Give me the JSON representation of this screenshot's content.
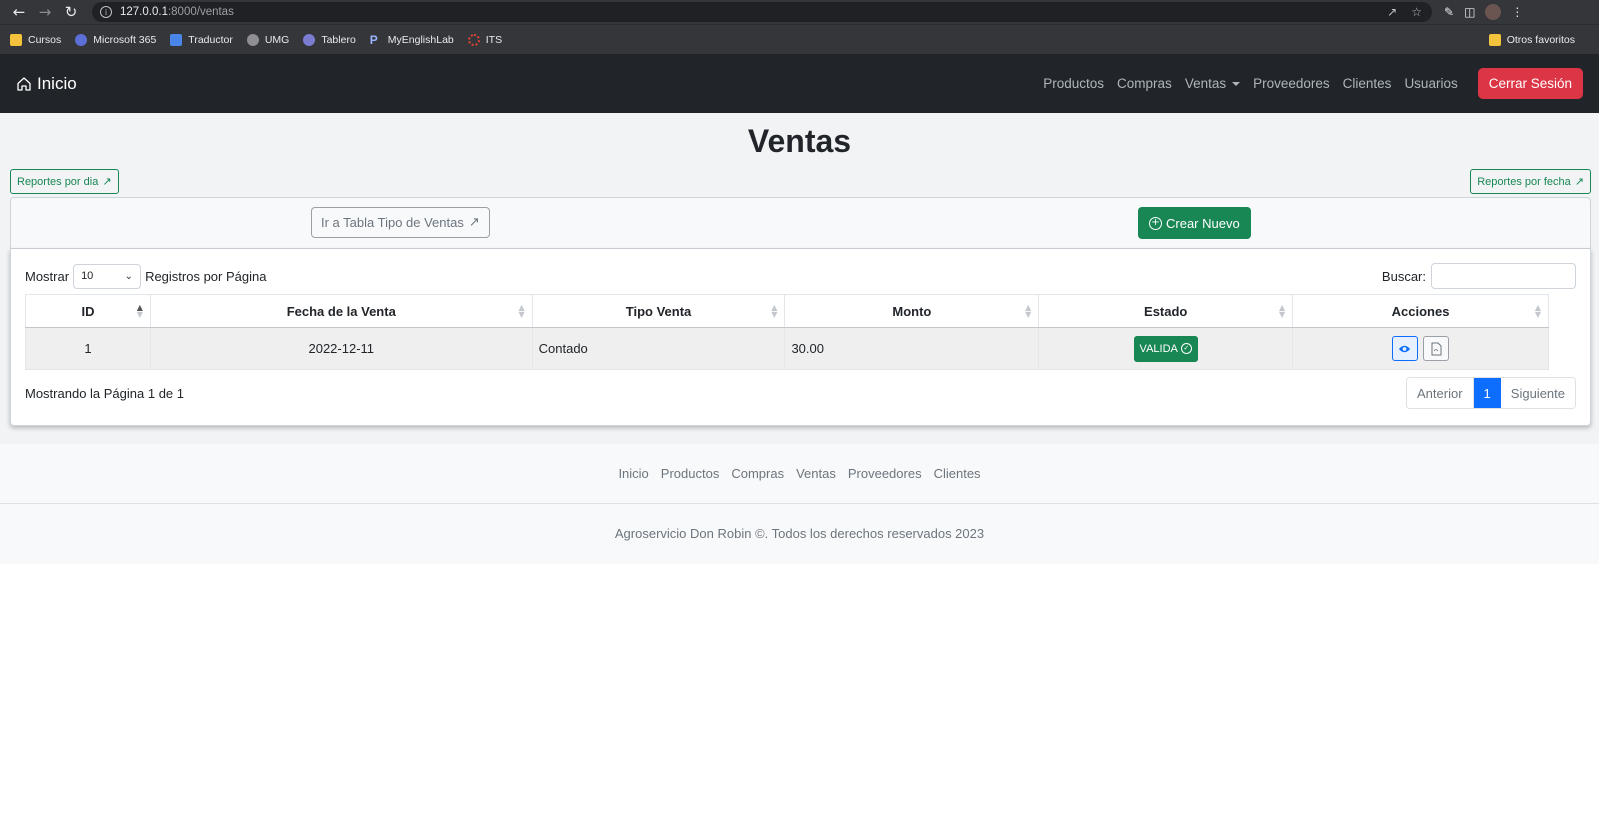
{
  "browser": {
    "url_host": "127.0.0.1",
    "url_path": ":8000/ventas",
    "bookmarks": [
      {
        "label": "Cursos",
        "icon": "folder-icon"
      },
      {
        "label": "Microsoft 365",
        "icon": "microsoft-365-icon"
      },
      {
        "label": "Traductor",
        "icon": "translate-icon"
      },
      {
        "label": "UMG",
        "icon": "umg-icon"
      },
      {
        "label": "Tablero",
        "icon": "tablero-icon"
      },
      {
        "label": "MyEnglishLab",
        "icon": "pearson-icon"
      },
      {
        "label": "ITS",
        "icon": "its-icon"
      }
    ],
    "other_bookmarks": "Otros favoritos"
  },
  "navbar": {
    "brand": "Inicio",
    "links": [
      "Productos",
      "Compras",
      "Ventas",
      "Proveedores",
      "Clientes",
      "Usuarios"
    ],
    "logout": "Cerrar Sesión"
  },
  "page": {
    "title": "Ventas",
    "report_day": "Reportes por dia",
    "report_date": "Reportes por fecha",
    "tipo_button": "Ir a Tabla Tipo de Ventas",
    "create_button": "Crear Nuevo"
  },
  "table": {
    "show_label": "Mostrar",
    "page_size": "10",
    "per_page_label": "Registros por Página",
    "search_label": "Buscar:",
    "search_value": "",
    "columns": [
      "ID",
      "Fecha de la Venta",
      "Tipo Venta",
      "Monto",
      "Estado",
      "Acciones"
    ],
    "rows": [
      {
        "id": "1",
        "fecha": "2022-12-11",
        "tipo": "Contado",
        "monto": "30.00",
        "estado": "VALIDA"
      }
    ],
    "info": "Mostrando la Página 1 de 1",
    "pager": {
      "prev": "Anterior",
      "current": "1",
      "next": "Siguiente"
    }
  },
  "footer": {
    "links": [
      "Inicio",
      "Productos",
      "Compras",
      "Ventas",
      "Proveedores",
      "Clientes"
    ],
    "copyright": "Agroservicio Don Robin ©. Todos los derechos reservados 2023"
  },
  "colors": {
    "navbar_bg": "#212529",
    "logout_red": "#dc3545",
    "success_green": "#198754",
    "primary_blue": "#0d6efd"
  }
}
